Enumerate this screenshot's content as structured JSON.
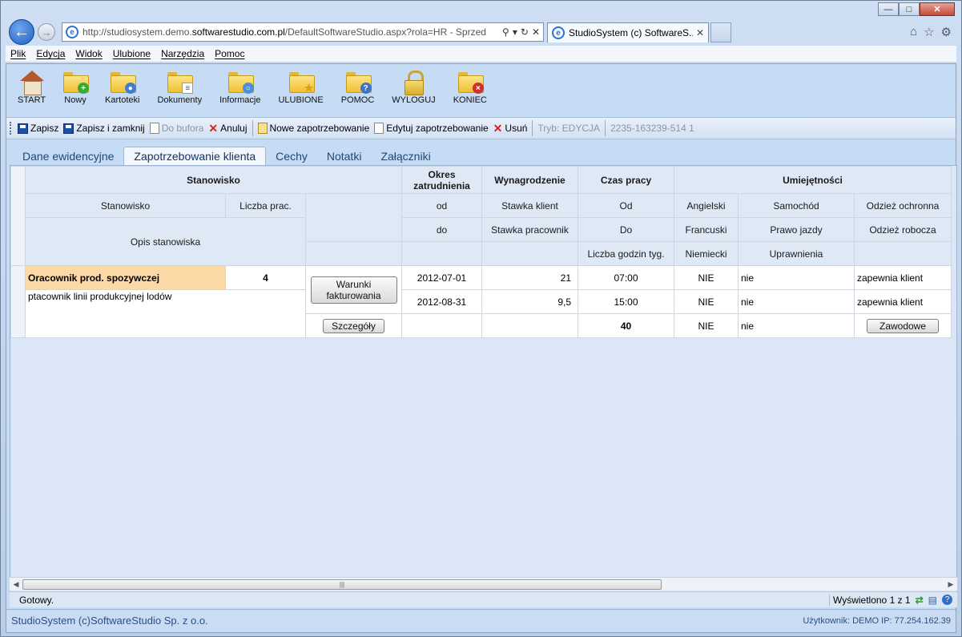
{
  "browser": {
    "url_prefix": "http://studiosystem.demo.",
    "url_host": "softwarestudio.com.pl",
    "url_path": "/DefaultSoftwareStudio.aspx?rola=HR - Sprzed",
    "tab_title": "StudioSystem (c) SoftwareS..."
  },
  "menu": [
    "Plik",
    "Edycja",
    "Widok",
    "Ulubione",
    "Narzędzia",
    "Pomoc"
  ],
  "bigtools": [
    {
      "label": "START",
      "icon": "home-icon"
    },
    {
      "label": "Nowy",
      "icon": "folder-add-icon",
      "color": "#3aa83a",
      "glyph": "+"
    },
    {
      "label": "Kartoteki",
      "icon": "folder-people-icon",
      "color": "#3f7fd0",
      "glyph": "●"
    },
    {
      "label": "Dokumenty",
      "icon": "folder-documents-icon",
      "color": "#ffffff",
      "glyph": "≡"
    },
    {
      "label": "Informacje",
      "icon": "folder-search-icon",
      "color": "#4a8fd8",
      "glyph": "○"
    },
    {
      "label": "ULUBIONE",
      "icon": "folder-star-icon",
      "color": "#f1c232",
      "glyph": "★"
    },
    {
      "label": "POMOC",
      "icon": "folder-help-icon",
      "color": "#3a72c8",
      "glyph": "?"
    },
    {
      "label": "WYLOGUJ",
      "icon": "lock-icon"
    },
    {
      "label": "KONIEC",
      "icon": "folder-close-icon",
      "color": "#d0302a",
      "glyph": "×"
    }
  ],
  "toolbar": {
    "save": "Zapisz",
    "save_close": "Zapisz i zamknij",
    "to_buffer": "Do bufora",
    "cancel": "Anuluj",
    "new_req": "Nowe zapotrzebowanie",
    "edit_req": "Edytuj zapotrzebowanie",
    "delete": "Usuń",
    "mode": "Tryb: EDYCJA",
    "record_id": "2235-163239-514  1"
  },
  "tabs": [
    "Dane ewidencyjne",
    "Zapotrzebowanie klienta",
    "Cechy",
    "Notatki",
    "Załączniki"
  ],
  "grid": {
    "groups": {
      "position": "Stanowisko",
      "period": "Okres zatrudnienia",
      "salary": "Wynagrodzenie",
      "hours": "Czas pracy",
      "skills": "Umiejętności"
    },
    "sub": {
      "position": "Stanowisko",
      "count": "Liczba prac.",
      "desc": "Opis stanowiska",
      "from": "od",
      "to": "do",
      "rate_client": "Stawka klient",
      "rate_worker": "Stawka pracownik",
      "time_from": "Od",
      "time_to": "Do",
      "weekly_hours": "Liczba godzin tyg.",
      "english": "Angielski",
      "french": "Francuski",
      "german": "Niemiecki",
      "car": "Samochód",
      "license": "Prawo jazdy",
      "permissions": "Uprawnienia",
      "protective": "Odzież ochronna",
      "workwear": "Odzież robocza"
    },
    "row": {
      "position": "Oracownik prod. spozywczej",
      "count": "4",
      "desc": "ptacownik linii produkcyjnej lodów",
      "billing_btn": "Warunki fakturowania",
      "details_btn": "Szczegóły",
      "date_from": "2012-07-01",
      "date_to": "2012-08-31",
      "rate_client": "21",
      "rate_worker": "9,5",
      "time_from": "07:00",
      "time_to": "15:00",
      "weekly_hours": "40",
      "english": "NIE",
      "french": "NIE",
      "german": "NIE",
      "car": "nie",
      "license": "nie",
      "permissions": "nie",
      "protective": "zapewnia klient",
      "workwear": "zapewnia klient",
      "prof_btn": "Zawodowe"
    }
  },
  "status": {
    "left": "Gotowy.",
    "right": "Wyświetlono 1 z 1"
  },
  "footer": {
    "left": "StudioSystem (c)SoftwareStudio Sp. z o.o.",
    "right": "Użytkownik: DEMO IP: 77.254.162.39"
  }
}
